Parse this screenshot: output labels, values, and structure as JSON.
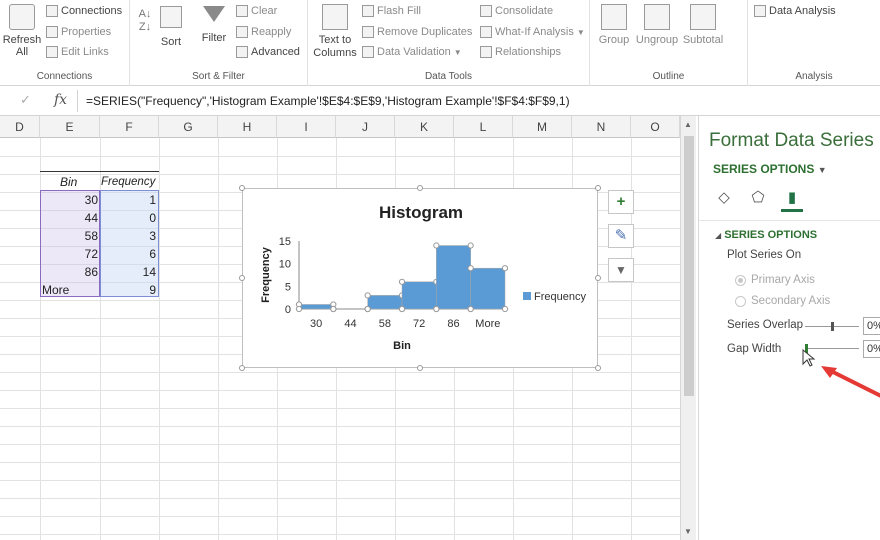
{
  "ribbon": {
    "connections_group": {
      "refresh_all": "Refresh\nAll",
      "connections": "Connections",
      "properties": "Properties",
      "edit_links": "Edit Links",
      "label": "Connections"
    },
    "sort_filter_group": {
      "sort": "Sort",
      "filter": "Filter",
      "clear": "Clear",
      "reapply": "Reapply",
      "advanced": "Advanced",
      "label": "Sort & Filter"
    },
    "data_tools_group": {
      "text_to_columns": "Text to\nColumns",
      "flash_fill": "Flash Fill",
      "remove_duplicates": "Remove Duplicates",
      "data_validation": "Data Validation",
      "consolidate": "Consolidate",
      "what_if": "What-If Analysis",
      "relationships": "Relationships",
      "label": "Data Tools"
    },
    "outline_group": {
      "group": "Group",
      "ungroup": "Ungroup",
      "subtotal": "Subtotal",
      "label": "Outline"
    },
    "analysis_group": {
      "data_analysis": "Data Analysis",
      "label": "Analysis"
    }
  },
  "formula_bar": {
    "formula": "=SERIES(\"Frequency\",'Histogram Example'!$E$4:$E$9,'Histogram Example'!$F$4:$F$9,1)"
  },
  "columns": [
    "D",
    "E",
    "F",
    "G",
    "H",
    "I",
    "J",
    "K",
    "L",
    "M",
    "N",
    "O"
  ],
  "table": {
    "header_bin": "Bin",
    "header_freq": "Frequency",
    "rows": [
      {
        "bin": "30",
        "freq": "1"
      },
      {
        "bin": "44",
        "freq": "0"
      },
      {
        "bin": "58",
        "freq": "3"
      },
      {
        "bin": "72",
        "freq": "6"
      },
      {
        "bin": "86",
        "freq": "14"
      },
      {
        "bin": "More",
        "freq": "9"
      }
    ]
  },
  "chart_data": {
    "type": "bar",
    "title": "Histogram",
    "xlabel": "Bin",
    "ylabel": "Frequency",
    "categories": [
      "30",
      "44",
      "58",
      "72",
      "86",
      "More"
    ],
    "series": [
      {
        "name": "Frequency",
        "values": [
          1,
          0,
          3,
          6,
          14,
          9
        ],
        "color": "#5b9bd5"
      }
    ],
    "yticks": [
      "0",
      "5",
      "10",
      "15"
    ],
    "ylim": [
      0,
      15
    ],
    "legend": "right",
    "gap_width_percent": 0
  },
  "chart_buttons": {
    "add": "+",
    "style": "✎",
    "filter": "▼"
  },
  "pane": {
    "title": "Format Data Series",
    "options_dropdown": "SERIES OPTIONS",
    "section": "SERIES OPTIONS",
    "plot_series_on": "Plot Series On",
    "primary_axis": "Primary Axis",
    "secondary_axis": "Secondary Axis",
    "series_overlap": "Series Overlap",
    "series_overlap_value": "0%",
    "gap_width": "Gap Width",
    "gap_width_value": "0%",
    "accent": "#217346"
  }
}
